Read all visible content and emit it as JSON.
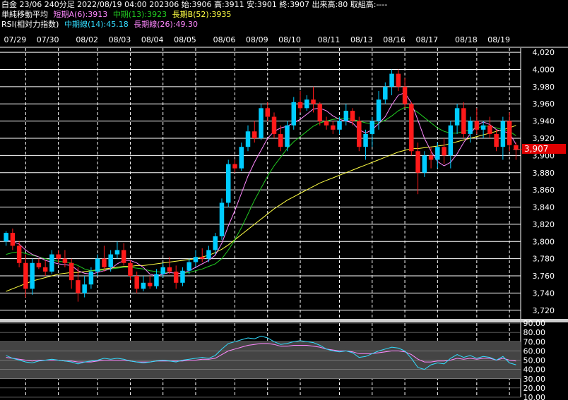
{
  "header": {
    "line1": "白金 23/06 240分足 2022/08/19 04:00 202306 始:3906 高:3911 安:3901 終:3907 出来高:80 取組高:----",
    "ma": {
      "label": "単純移動平均",
      "short": "短期A(6):3913",
      "mid": "中期(13):3923",
      "long": "長期B(52):3935"
    },
    "rsi": {
      "label": "RSI(相対力指数)",
      "mid": "中期線(14):45.18",
      "long": "長期線(26):49.30"
    }
  },
  "colors": {
    "up": "#00ccff",
    "down": "#ff1a1a",
    "ma_short": "#ff88ff",
    "ma_mid": "#22cc22",
    "ma_long": "#ffff44",
    "rsi_mid": "#33ddff",
    "rsi_long": "#ff88ff",
    "last_price_bg": "#e00000"
  },
  "chart_data": [
    {
      "type": "candlestick",
      "dates": [
        "07/29",
        "07/30",
        "08/02",
        "08/03",
        "08/04",
        "08/05",
        "08/06",
        "08/09",
        "08/10",
        "08/11",
        "08/13",
        "08/16",
        "08/17",
        "08/18",
        "08/19"
      ],
      "ylim": [
        3710,
        4025
      ],
      "yticks": [
        3720,
        3740,
        3760,
        3780,
        3800,
        3820,
        3840,
        3860,
        3880,
        3900,
        3920,
        3940,
        3960,
        3980,
        4000,
        4020
      ],
      "last_price": "3,907",
      "ohlc": [
        [
          3800,
          3812,
          3795,
          3810
        ],
        [
          3810,
          3815,
          3790,
          3795
        ],
        [
          3795,
          3800,
          3770,
          3775
        ],
        [
          3775,
          3785,
          3735,
          3745
        ],
        [
          3745,
          3780,
          3738,
          3775
        ],
        [
          3775,
          3780,
          3768,
          3770
        ],
        [
          3770,
          3778,
          3760,
          3765
        ],
        [
          3765,
          3790,
          3762,
          3785
        ],
        [
          3785,
          3790,
          3775,
          3780
        ],
        [
          3780,
          3790,
          3770,
          3775
        ],
        [
          3775,
          3780,
          3745,
          3755
        ],
        [
          3755,
          3770,
          3730,
          3740
        ],
        [
          3740,
          3760,
          3735,
          3750
        ],
        [
          3750,
          3770,
          3745,
          3765
        ],
        [
          3765,
          3785,
          3760,
          3780
        ],
        [
          3780,
          3795,
          3765,
          3770
        ],
        [
          3770,
          3790,
          3765,
          3785
        ],
        [
          3785,
          3800,
          3780,
          3790
        ],
        [
          3790,
          3798,
          3772,
          3775
        ],
        [
          3775,
          3778,
          3755,
          3760
        ],
        [
          3760,
          3765,
          3740,
          3745
        ],
        [
          3745,
          3760,
          3742,
          3752
        ],
        [
          3752,
          3760,
          3745,
          3748
        ],
        [
          3748,
          3768,
          3745,
          3762
        ],
        [
          3762,
          3775,
          3758,
          3770
        ],
        [
          3770,
          3782,
          3762,
          3765
        ],
        [
          3765,
          3772,
          3745,
          3752
        ],
        [
          3752,
          3770,
          3748,
          3766
        ],
        [
          3766,
          3780,
          3762,
          3776
        ],
        [
          3776,
          3790,
          3770,
          3782
        ],
        [
          3782,
          3792,
          3776,
          3780
        ],
        [
          3780,
          3795,
          3776,
          3790
        ],
        [
          3790,
          3810,
          3785,
          3806
        ],
        [
          3806,
          3850,
          3802,
          3845
        ],
        [
          3845,
          3895,
          3840,
          3890
        ],
        [
          3890,
          3895,
          3880,
          3885
        ],
        [
          3885,
          3915,
          3882,
          3910
        ],
        [
          3910,
          3935,
          3905,
          3928
        ],
        [
          3928,
          3940,
          3915,
          3920
        ],
        [
          3920,
          3960,
          3918,
          3955
        ],
        [
          3955,
          3962,
          3940,
          3945
        ],
        [
          3945,
          3950,
          3920,
          3925
        ],
        [
          3925,
          3935,
          3905,
          3910
        ],
        [
          3910,
          3940,
          3905,
          3935
        ],
        [
          3935,
          3968,
          3930,
          3962
        ],
        [
          3962,
          3975,
          3950,
          3955
        ],
        [
          3955,
          3970,
          3952,
          3965
        ],
        [
          3965,
          3980,
          3950,
          3960
        ],
        [
          3960,
          3962,
          3935,
          3940
        ],
        [
          3940,
          3945,
          3930,
          3935
        ],
        [
          3935,
          3940,
          3925,
          3930
        ],
        [
          3930,
          3945,
          3925,
          3940
        ],
        [
          3940,
          3960,
          3935,
          3952
        ],
        [
          3952,
          3955,
          3935,
          3940
        ],
        [
          3940,
          3945,
          3905,
          3910
        ],
        [
          3910,
          3930,
          3895,
          3925
        ],
        [
          3925,
          3945,
          3910,
          3940
        ],
        [
          3940,
          3975,
          3930,
          3965
        ],
        [
          3965,
          3985,
          3960,
          3980
        ],
        [
          3980,
          4000,
          3970,
          3995
        ],
        [
          3995,
          4000,
          3975,
          3980
        ],
        [
          3980,
          3990,
          3955,
          3960
        ],
        [
          3960,
          3962,
          3900,
          3905
        ],
        [
          3905,
          3915,
          3855,
          3880
        ],
        [
          3880,
          3905,
          3875,
          3900
        ],
        [
          3900,
          3910,
          3885,
          3895
        ],
        [
          3895,
          3915,
          3885,
          3910
        ],
        [
          3910,
          3920,
          3890,
          3900
        ],
        [
          3900,
          3940,
          3885,
          3935
        ],
        [
          3935,
          3960,
          3925,
          3955
        ],
        [
          3955,
          3962,
          3920,
          3925
        ],
        [
          3925,
          3945,
          3915,
          3940
        ],
        [
          3940,
          3955,
          3925,
          3930
        ],
        [
          3930,
          3940,
          3920,
          3935
        ],
        [
          3935,
          3945,
          3920,
          3925
        ],
        [
          3925,
          3930,
          3905,
          3910
        ],
        [
          3910,
          3945,
          3895,
          3940
        ],
        [
          3940,
          3950,
          3905,
          3912
        ],
        [
          3912,
          3915,
          3895,
          3907
        ]
      ],
      "ma_short": [
        3802,
        3800,
        3797,
        3790,
        3785,
        3782,
        3778,
        3776,
        3774,
        3773,
        3772,
        3766,
        3763,
        3762,
        3764,
        3766,
        3768,
        3774,
        3778,
        3778,
        3775,
        3770,
        3762,
        3760,
        3762,
        3764,
        3763,
        3763,
        3766,
        3770,
        3774,
        3778,
        3784,
        3798,
        3818,
        3836,
        3856,
        3876,
        3892,
        3906,
        3920,
        3928,
        3932,
        3934,
        3938,
        3942,
        3948,
        3954,
        3955,
        3952,
        3946,
        3942,
        3940,
        3938,
        3930,
        3926,
        3930,
        3937,
        3945,
        3959,
        3970,
        3973,
        3961,
        3941,
        3920,
        3905,
        3893,
        3888,
        3892,
        3902,
        3915,
        3925,
        3935,
        3939,
        3936,
        3930,
        3928,
        3926,
        3913
      ],
      "ma_mid": [
        3785,
        3787,
        3788,
        3786,
        3784,
        3782,
        3780,
        3778,
        3777,
        3776,
        3775,
        3772,
        3768,
        3766,
        3766,
        3767,
        3768,
        3769,
        3770,
        3770,
        3769,
        3768,
        3766,
        3765,
        3764,
        3764,
        3763,
        3763,
        3764,
        3766,
        3768,
        3771,
        3774,
        3780,
        3790,
        3802,
        3816,
        3832,
        3848,
        3862,
        3876,
        3888,
        3898,
        3908,
        3916,
        3922,
        3928,
        3934,
        3938,
        3940,
        3942,
        3943,
        3943,
        3942,
        3940,
        3938,
        3937,
        3938,
        3941,
        3946,
        3952,
        3956,
        3955,
        3950,
        3944,
        3938,
        3932,
        3928,
        3926,
        3926,
        3928,
        3930,
        3932,
        3934,
        3934,
        3932,
        3930,
        3928,
        3923
      ],
      "ma_long": [
        3742,
        3745,
        3748,
        3751,
        3754,
        3756,
        3758,
        3760,
        3762,
        3763,
        3764,
        3764,
        3765,
        3766,
        3767,
        3768,
        3769,
        3770,
        3771,
        3771,
        3772,
        3772,
        3773,
        3774,
        3775,
        3776,
        3777,
        3778,
        3779,
        3780,
        3782,
        3784,
        3787,
        3791,
        3796,
        3802,
        3808,
        3814,
        3820,
        3826,
        3832,
        3838,
        3843,
        3848,
        3852,
        3856,
        3860,
        3864,
        3868,
        3871,
        3874,
        3877,
        3880,
        3883,
        3886,
        3889,
        3892,
        3895,
        3898,
        3901,
        3904,
        3906,
        3908,
        3908,
        3909,
        3910,
        3911,
        3912,
        3914,
        3916,
        3918,
        3920,
        3922,
        3924,
        3926,
        3928,
        3930,
        3932,
        3935
      ]
    },
    {
      "type": "line",
      "name": "RSI",
      "ylim": [
        10,
        90
      ],
      "yticks": [
        10.0,
        20.0,
        30.0,
        40.0,
        50.0,
        60.0,
        70.0,
        80.0,
        90.0
      ],
      "rsi_mid": [
        55,
        52,
        50,
        48,
        47,
        49,
        50,
        51,
        50,
        49,
        48,
        46,
        48,
        49,
        50,
        52,
        51,
        52,
        51,
        49,
        48,
        47,
        48,
        49,
        50,
        49,
        48,
        50,
        51,
        52,
        53,
        52,
        55,
        62,
        68,
        70,
        72,
        74,
        73,
        76,
        74,
        70,
        67,
        68,
        70,
        71,
        70,
        69,
        66,
        62,
        60,
        59,
        60,
        58,
        53,
        54,
        57,
        60,
        62,
        64,
        63,
        60,
        52,
        42,
        40,
        45,
        47,
        46,
        52,
        56,
        53,
        55,
        52,
        54,
        53,
        50,
        54,
        47,
        45
      ],
      "rsi_long": [
        53,
        52,
        51,
        50,
        49,
        50,
        50,
        50,
        50,
        49,
        49,
        48,
        48,
        48,
        49,
        50,
        50,
        50,
        50,
        49,
        48,
        48,
        48,
        49,
        49,
        49,
        49,
        49,
        50,
        50,
        51,
        51,
        52,
        56,
        60,
        62,
        64,
        66,
        67,
        68,
        68,
        67,
        65,
        65,
        66,
        66,
        66,
        65,
        64,
        62,
        61,
        60,
        60,
        59,
        57,
        57,
        57,
        58,
        59,
        60,
        60,
        59,
        56,
        51,
        48,
        48,
        49,
        49,
        50,
        52,
        51,
        52,
        51,
        52,
        52,
        50,
        52,
        50,
        49
      ]
    }
  ]
}
